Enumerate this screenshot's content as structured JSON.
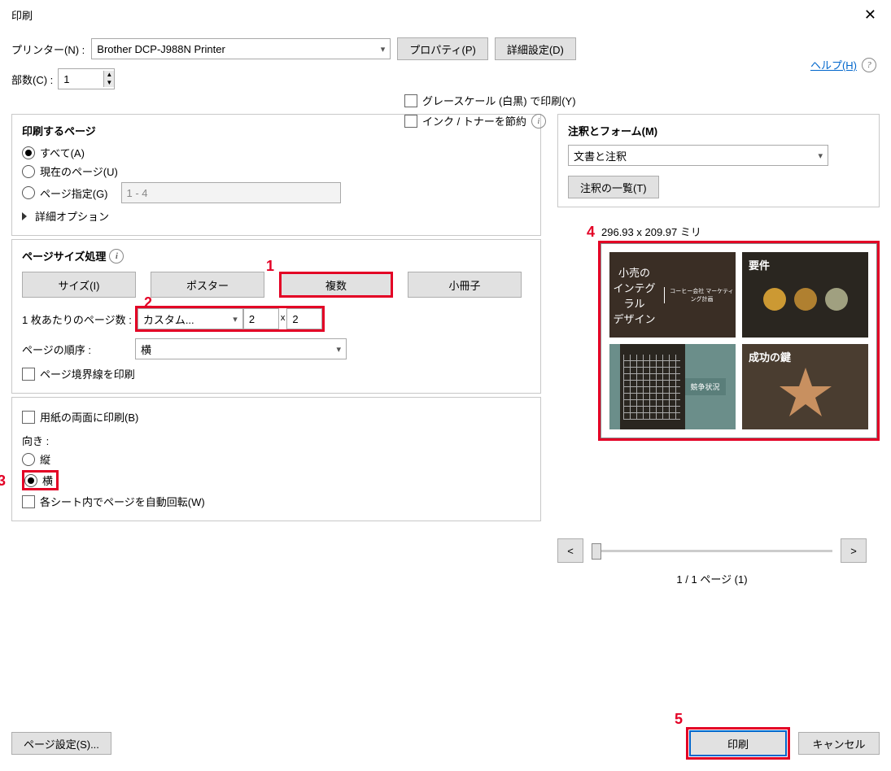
{
  "title": "印刷",
  "printer": {
    "label": "プリンター(N) :",
    "value": "Brother DCP-J988N Printer"
  },
  "properties": "プロパティ(P)",
  "advanced": "詳細設定(D)",
  "help": "ヘルプ(H)",
  "copies": {
    "label": "部数(C) :",
    "value": "1"
  },
  "grayscale": "グレースケール (白黒) で印刷(Y)",
  "savetoner": "インク / トナーを節約",
  "pages_group": {
    "title": "印刷するページ",
    "all": "すべて(A)",
    "current": "現在のページ(U)",
    "range_label": "ページ指定(G)",
    "range_value": "1 - 4",
    "more": "詳細オプション"
  },
  "sizing": {
    "title": "ページサイズ処理",
    "tabs": {
      "size": "サイズ(I)",
      "poster": "ポスター",
      "multiple": "複数",
      "booklet": "小冊子"
    },
    "pps_label": "1 枚あたりのページ数 :",
    "pps_value": "カスタム...",
    "cols": "2",
    "by": "x",
    "rows": "2",
    "order_label": "ページの順序 :",
    "order_value": "横",
    "border": "ページ境界線を印刷"
  },
  "both_sides": "用紙の両面に印刷(B)",
  "orientation": {
    "label": "向き :",
    "portrait": "縦",
    "landscape": "横",
    "auto": "各シート内でページを自動回転(W)"
  },
  "annotations": {
    "title": "注釈とフォーム(M)",
    "value": "文書と注釈",
    "list": "注釈の一覧(T)"
  },
  "preview": {
    "dims": "296.93 x 209.97 ミリ",
    "t1_line1": "小売の",
    "t1_line2": "インテグラル",
    "t1_line3": "デザイン",
    "t1_sub": "コーヒー会社\nマーケティング計画",
    "t2_title": "要件",
    "t3_band": "競争状況",
    "t4_title": "成功の鍵"
  },
  "pager": {
    "prev": "<",
    "next": ">",
    "label": "1 / 1 ページ (1)"
  },
  "footer": {
    "page_setup": "ページ設定(S)...",
    "print": "印刷",
    "cancel": "キャンセル"
  },
  "ann": {
    "n1": "1",
    "n2": "2",
    "n3": "3",
    "n4": "4",
    "n5": "5"
  }
}
